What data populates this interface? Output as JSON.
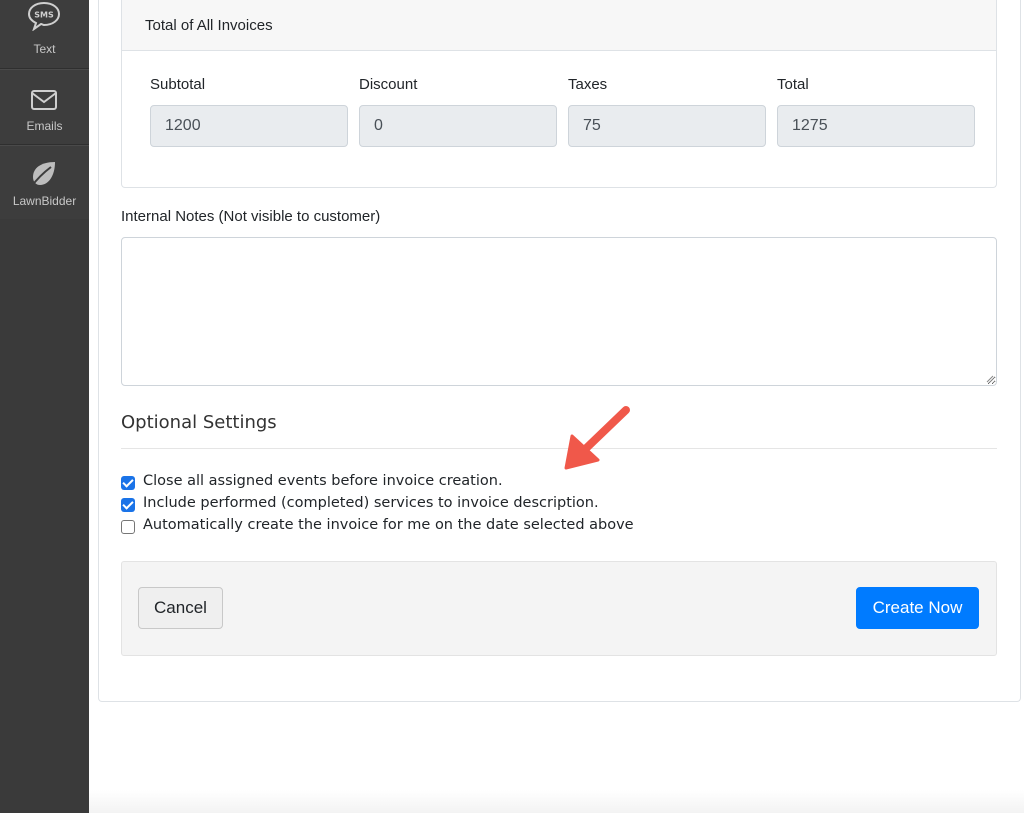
{
  "sidebar": {
    "items": [
      {
        "label": "Text",
        "icon": "sms-icon"
      },
      {
        "label": "Emails",
        "icon": "envelope-icon"
      },
      {
        "label": "LawnBidder",
        "icon": "leaf-icon"
      }
    ]
  },
  "totals": {
    "title": "Total of All Invoices",
    "fields": [
      {
        "label": "Subtotal",
        "value": "1200"
      },
      {
        "label": "Discount",
        "value": "0"
      },
      {
        "label": "Taxes",
        "value": "75"
      },
      {
        "label": "Total",
        "value": "1275"
      }
    ]
  },
  "notes": {
    "label": "Internal Notes (Not visible to customer)",
    "value": ""
  },
  "optional_settings": {
    "title": "Optional Settings",
    "options": [
      {
        "label": "Close all assigned events before invoice creation.",
        "checked": true
      },
      {
        "label": "Include performed (completed) services to invoice description.",
        "checked": true
      },
      {
        "label": "Automatically create the invoice for me on the date selected above",
        "checked": false
      }
    ]
  },
  "actions": {
    "cancel_label": "Cancel",
    "create_label": "Create Now"
  },
  "colors": {
    "sidebar_bg": "#3d3d3d",
    "primary": "#007bff",
    "checkbox_accent": "#1a73e8",
    "annotation_arrow": "#f0584a"
  }
}
